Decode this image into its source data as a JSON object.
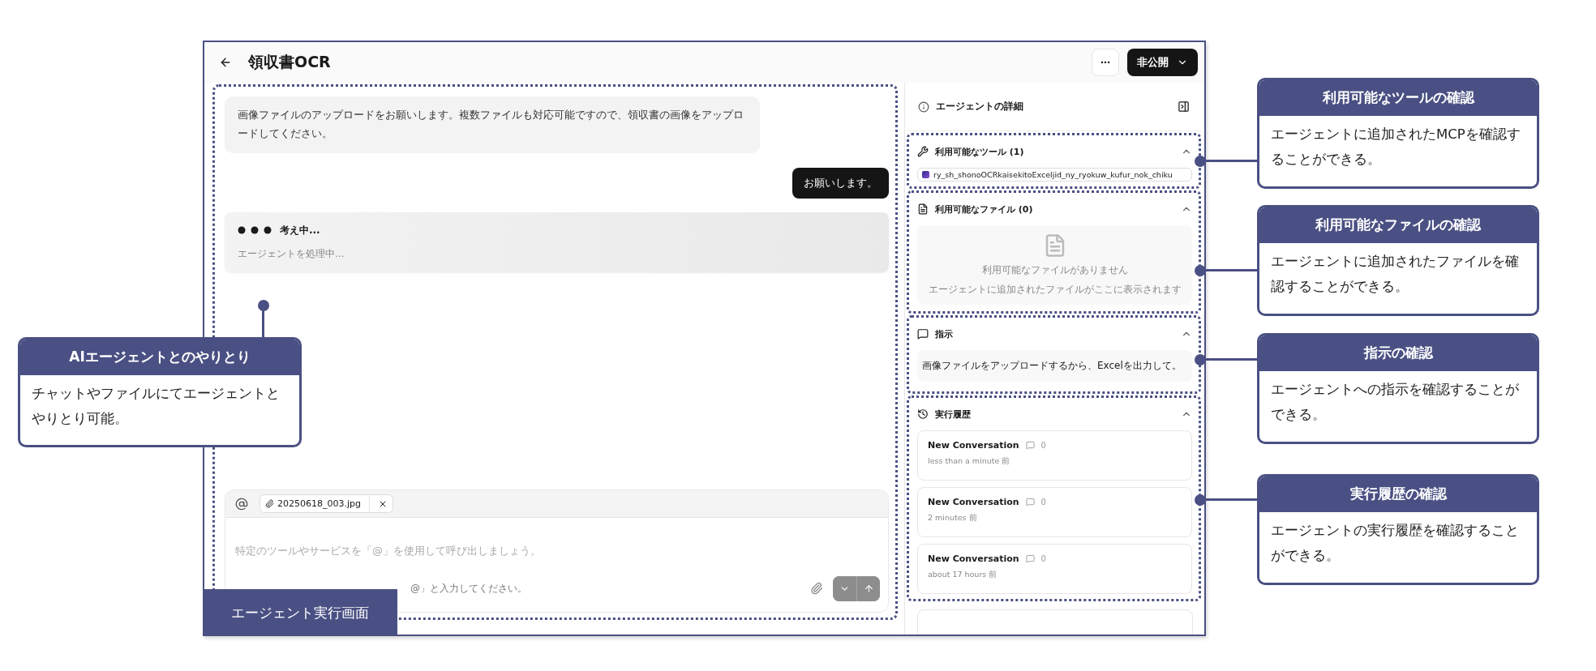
{
  "app": {
    "title": "領収書OCR",
    "visibility": "非公開"
  },
  "chat": {
    "messages": [
      {
        "kind": "agent",
        "text": "画像ファイルのアップロードをお願いします。複数ファイルも対応可能ですので、領収書の画像をアップロードしてください。"
      },
      {
        "kind": "user",
        "text": "お願いします。"
      }
    ],
    "thinking": {
      "title": "考え中...",
      "subtitle": "エージェントを処理中..."
    },
    "composer": {
      "attachment": "20250618_003.jpg",
      "placeholder": "特定のツールやサービスを「@」を使用して呼び出しましょう。",
      "hint": "@」と入力してください。"
    }
  },
  "details": {
    "title": "エージェントの詳細",
    "sections": [
      {
        "kind": "tools",
        "title": "利用可能なツール (1)",
        "expanded": true,
        "tools": [
          "ry_sh_shonoOCRkaisekitoExceljid_ny_ryokuw_kufur_nok_chiku"
        ]
      },
      {
        "kind": "files",
        "title": "利用可能なファイル (0)",
        "expanded": true,
        "empty_title": "利用可能なファイルがありません",
        "empty_text": "エージェントに追加されたファイルがここに表示されます"
      },
      {
        "kind": "instructions",
        "title": "指示",
        "expanded": true,
        "text": "画像ファイルをアップロードするから、Excelを出力して。"
      },
      {
        "kind": "history",
        "title": "実行履歴",
        "expanded": true,
        "conversations": [
          {
            "title": "New Conversation",
            "count": "0",
            "time": "less than a minute 前"
          },
          {
            "title": "New Conversation",
            "count": "0",
            "time": "2 minutes 前"
          },
          {
            "title": "New Conversation",
            "count": "0",
            "time": "about 17 hours 前"
          }
        ]
      }
    ]
  },
  "annotations": {
    "left": {
      "title": "AIエージェントとのやりとり",
      "text": "チャットやファイルにてエージェントとやりとり可能。"
    },
    "right": [
      {
        "title": "利用可能なツールの確認",
        "text": "エージェントに追加されたMCPを確認することができる。"
      },
      {
        "title": "利用可能なファイルの確認",
        "text": "エージェントに追加されたファイルを確認することができる。"
      },
      {
        "title": "指示の確認",
        "text": "エージェントへの指示を確認することができる。"
      },
      {
        "title": "実行履歴の確認",
        "text": "エージェントの実行履歴を確認することができる。"
      }
    ],
    "screen_label": "エージェント実行画面"
  }
}
